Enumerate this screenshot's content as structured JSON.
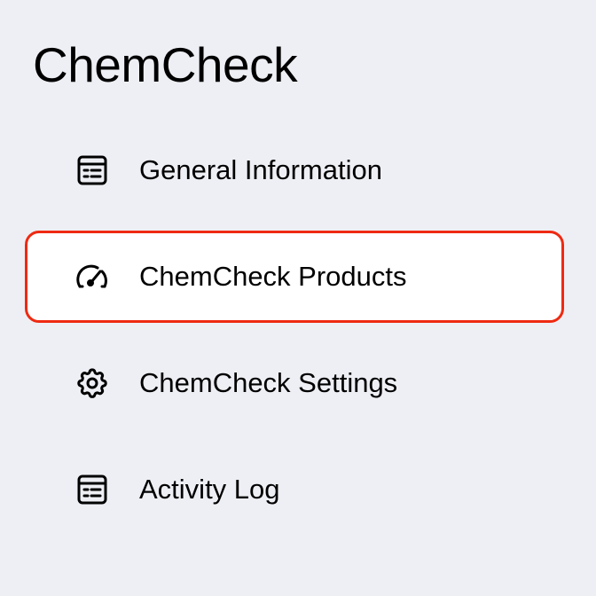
{
  "app": {
    "title": "ChemCheck"
  },
  "nav": {
    "items": [
      {
        "label": "General Information",
        "icon": "document-list-icon",
        "active": false
      },
      {
        "label": "ChemCheck Products",
        "icon": "speedometer-icon",
        "active": true
      },
      {
        "label": "ChemCheck Settings",
        "icon": "gear-icon",
        "active": false
      },
      {
        "label": "Activity Log",
        "icon": "document-list-icon",
        "active": false
      }
    ]
  },
  "colors": {
    "background": "#eeeff4",
    "active_background": "#ffffff",
    "active_border": "#ee2a12",
    "text": "#000000"
  }
}
